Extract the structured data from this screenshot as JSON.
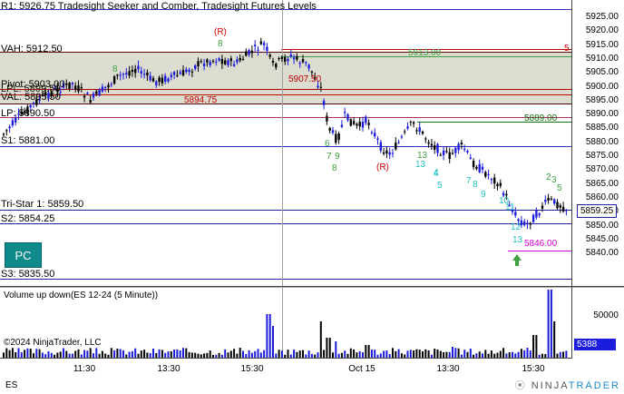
{
  "window": {
    "title": "R1: 5926.75  Tradesight Seeker and Comber, Tradesight Futures Levels",
    "instrument": "ES",
    "pc_button": "PC"
  },
  "volume_panel": {
    "title": "Volume up down(ES 12-24 (5 Minute))",
    "copyright": "©2024 NinjaTrader, LLC",
    "axis_label": "50000",
    "last_volume": "5388"
  },
  "price_axis": {
    "ticks": [
      "5925.00",
      "5920.00",
      "5915.00",
      "5910.00",
      "5905.00",
      "5900.00",
      "5895.00",
      "5890.00",
      "5885.00",
      "5880.00",
      "5875.00",
      "5870.00",
      "5865.00",
      "5860.00",
      "5855.00",
      "5850.00",
      "5845.00",
      "5840.00"
    ],
    "last_price": "5859.25"
  },
  "time_axis": {
    "ticks": [
      "11:30",
      "13:30",
      "15:30",
      "Oct 15",
      "13:30",
      "15:30"
    ]
  },
  "levels": [
    {
      "label": "VAH: 5912.50",
      "color": "#5b0000"
    },
    {
      "label": "Pivot: 5903.00",
      "color": "#b00000"
    },
    {
      "label": "LPL: 5899.50",
      "color": "#b00000"
    },
    {
      "label": "VAL: 5895.50",
      "color": "#5b0000"
    },
    {
      "label": "LP: 5890.50",
      "color": "#b00000"
    },
    {
      "label": "S1: 5881.00",
      "color": "#000080"
    },
    {
      "label": "Tri-Star 1: 5859.50",
      "color": "#000080"
    },
    {
      "label": "S2: 5854.25",
      "color": "#000080"
    },
    {
      "label": "S3: 5835.50",
      "color": "#000080"
    }
  ],
  "chart_annotations": {
    "level_values": [
      "5913.00",
      "5907.50",
      "5894.75",
      "5889.00",
      "5846.00"
    ],
    "signal_R": [
      "(R)",
      "(R)"
    ],
    "marker_5": "5",
    "counts_green": [
      "8",
      "8",
      "7",
      "9",
      "8",
      "6",
      "7",
      "9",
      "8",
      "13",
      "4",
      "5",
      "7",
      "8",
      "9",
      "2",
      "3",
      "5"
    ],
    "counts_cyan": [
      "13",
      "4",
      "5",
      "10",
      "11",
      "12",
      "13"
    ]
  },
  "branding": {
    "logo_a": "NINJA",
    "logo_b": "TRADER"
  },
  "colors": {
    "up_bar": "#1c1cdc",
    "down_bar": "#000000",
    "value_area": "#d8d8cc",
    "accent": "#0e8a8a"
  }
}
